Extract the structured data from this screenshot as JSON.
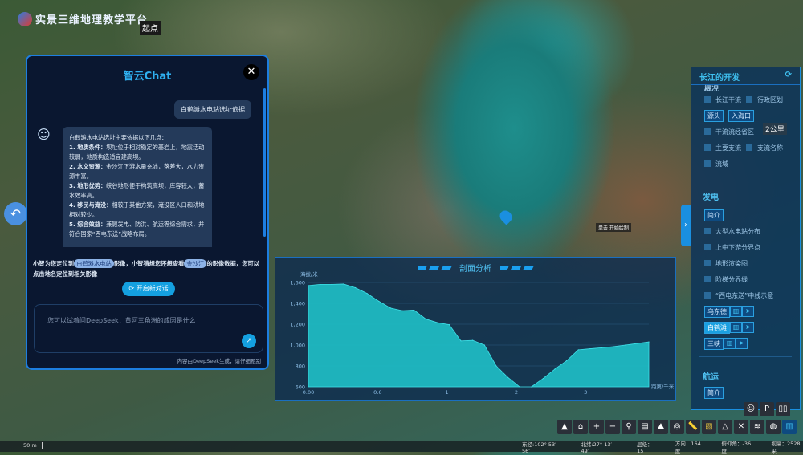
{
  "app": {
    "title": "实景三维地理教学平台",
    "start_label": "起点"
  },
  "map": {
    "draw_hint": "单击 开始绘制",
    "distance_label": "2公里",
    "scale": "50 m"
  },
  "chat": {
    "title": "智云Chat",
    "user_message": "白鹤滩水电站选址依据",
    "bot_intro": "白鹤滩水电站选址主要依据以下几点：",
    "bot_points": [
      {
        "head": "1. 地质条件：",
        "body": "坝址位于相对稳定的基岩上，地震活动较弱，地质构造适宜建高坝。"
      },
      {
        "head": "2. 水文资源：",
        "body": "金沙江下游水量充沛，落差大，水力资源丰富。"
      },
      {
        "head": "3. 地形优势：",
        "body": "峡谷地形便于构筑高坝，库容较大，蓄水效率高。"
      },
      {
        "head": "4. 移民与淹没：",
        "body": "相较于其他方案，淹没区人口和耕地相对较少。"
      },
      {
        "head": "5. 综合效益：",
        "body": "兼顾发电、防洪、航运等综合需求，并符合国家“西电东送”战略布局。"
      }
    ],
    "hint_pre": "小智为您定位到",
    "hint_chip1": "白鹤滩水电站",
    "hint_mid": "影像，小智猜想您还想查看",
    "hint_chip2": "金沙江",
    "hint_post": "的影像数据，您可以点击地名定位到相关影像",
    "new_chat": "开启新对话",
    "input_placeholder": "您可以试着问DeepSeek：黄河三角洲的成因是什么",
    "disclaimer": "内容由DeepSeek生成，请仔细甄别"
  },
  "panel": {
    "title": "长江的开发",
    "overview_title": "概况",
    "overview": {
      "c1": "长江干流",
      "c2": "行政区划",
      "b1": "源头",
      "b2": "入海口",
      "c3": "干流流经省区",
      "c4": "主要支流",
      "c5": "支流名称",
      "c6": "流域"
    },
    "power_title": "发电",
    "intro": "简介",
    "power": [
      "大型水电站分布",
      "上中下游分界点",
      "地形渲染图",
      "阶梯分界线",
      "“西电东送”中线示意"
    ],
    "stations": [
      {
        "name": "乌东德",
        "active": false
      },
      {
        "name": "白鹤滩",
        "active": true
      },
      {
        "name": "三峡",
        "active": false
      }
    ],
    "shipping_title": "航运"
  },
  "chart_data": {
    "type": "area",
    "title": "剖面分析",
    "ylabel": "海拔/米",
    "xlabel": "距离/千米",
    "ylim": [
      600,
      1600
    ],
    "yticks": [
      "600",
      "800",
      "1,000",
      "1,200",
      "1,400",
      "1,600"
    ],
    "xticks": [
      "0.00",
      "0.6",
      "1",
      "2",
      "3"
    ],
    "grid": true,
    "color": "#1fc0c8",
    "elevations": [
      1570,
      1582,
      1582,
      1585,
      1550,
      1495,
      1420,
      1355,
      1330,
      1335,
      1250,
      1215,
      1195,
      1040,
      1045,
      1000,
      800,
      690,
      600,
      600,
      680,
      770,
      850,
      955,
      965,
      975,
      985,
      1000,
      1015,
      1030
    ]
  },
  "status": {
    "lon": "东经:102° 53′ 56″",
    "lat": "北纬:27° 13′ 49″",
    "level": "层级：15",
    "heading": "方向：164度",
    "pitch": "俯仰角：-36度",
    "height": "视高：2528米"
  }
}
